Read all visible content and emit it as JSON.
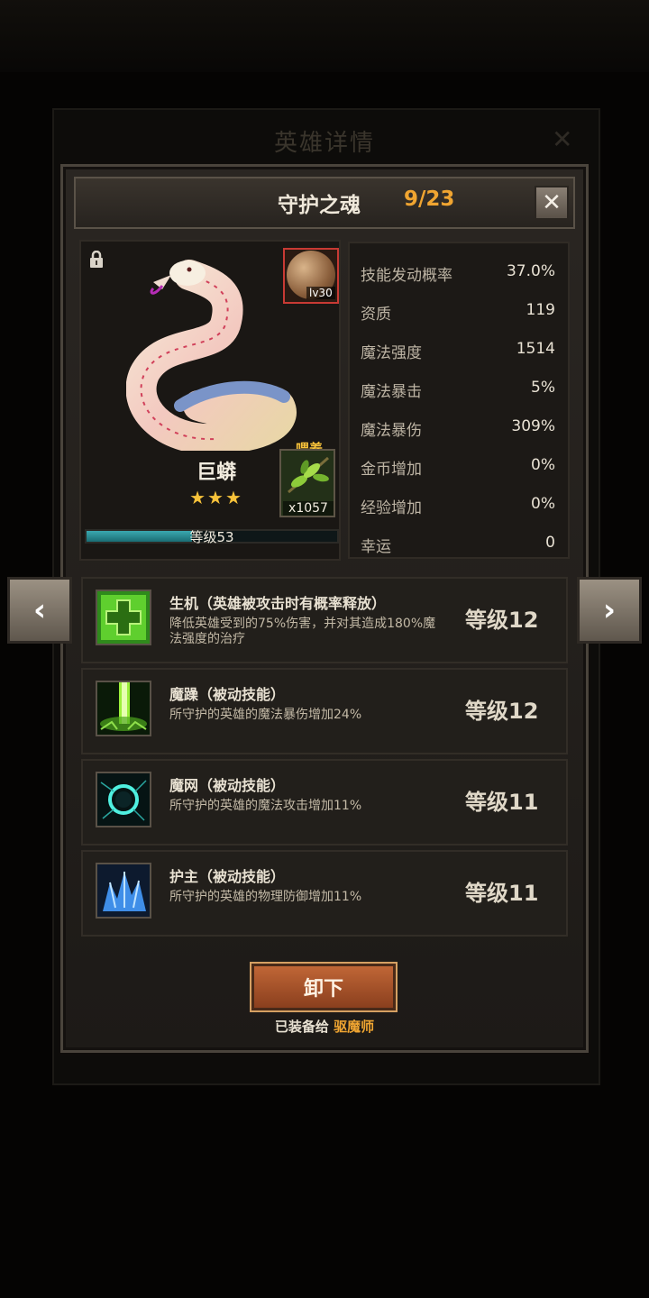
{
  "background": {
    "title": "英雄详情"
  },
  "header": {
    "name": "守护之魂",
    "count": "9/23",
    "close": "✕"
  },
  "hero": {
    "name": "巨蟒",
    "stars": "★★★",
    "level_text": "等级53",
    "level_progress": 0.42,
    "orb_level": "lv30",
    "feed_label": "喂养",
    "feed_count": "x1057"
  },
  "stats": [
    {
      "label": "技能发动概率",
      "value": "37.0%"
    },
    {
      "label": "资质",
      "value": "119"
    },
    {
      "label": "魔法强度",
      "value": "1514"
    },
    {
      "label": "魔法暴击",
      "value": "5%"
    },
    {
      "label": "魔法暴伤",
      "value": "309%"
    },
    {
      "label": "金币增加",
      "value": "0%"
    },
    {
      "label": "经验增加",
      "value": "0%"
    },
    {
      "label": "幸运",
      "value": "0"
    }
  ],
  "skills": [
    {
      "title": "生机（英雄被攻击时有概率释放）",
      "desc": "降低英雄受到的75%伤害，并对其造成180%魔法强度的治疗",
      "level": "等级12",
      "icon": "heal-cross-icon"
    },
    {
      "title": "魔躁（被动技能）",
      "desc": "所守护的英雄的魔法暴伤增加24%",
      "level": "等级12",
      "icon": "green-beam-icon"
    },
    {
      "title": "魔网（被动技能）",
      "desc": "所守护的英雄的魔法攻击增加11%",
      "level": "等级11",
      "icon": "magic-ring-icon"
    },
    {
      "title": "护主（被动技能）",
      "desc": "所守护的英雄的物理防御增加11%",
      "level": "等级11",
      "icon": "ice-crystal-icon"
    }
  ],
  "actions": {
    "unequip": "卸下",
    "equipped_prefix": "已装备给",
    "equipped_to": "驱魔师"
  },
  "nav": {
    "prev": "‹",
    "next": "›"
  }
}
